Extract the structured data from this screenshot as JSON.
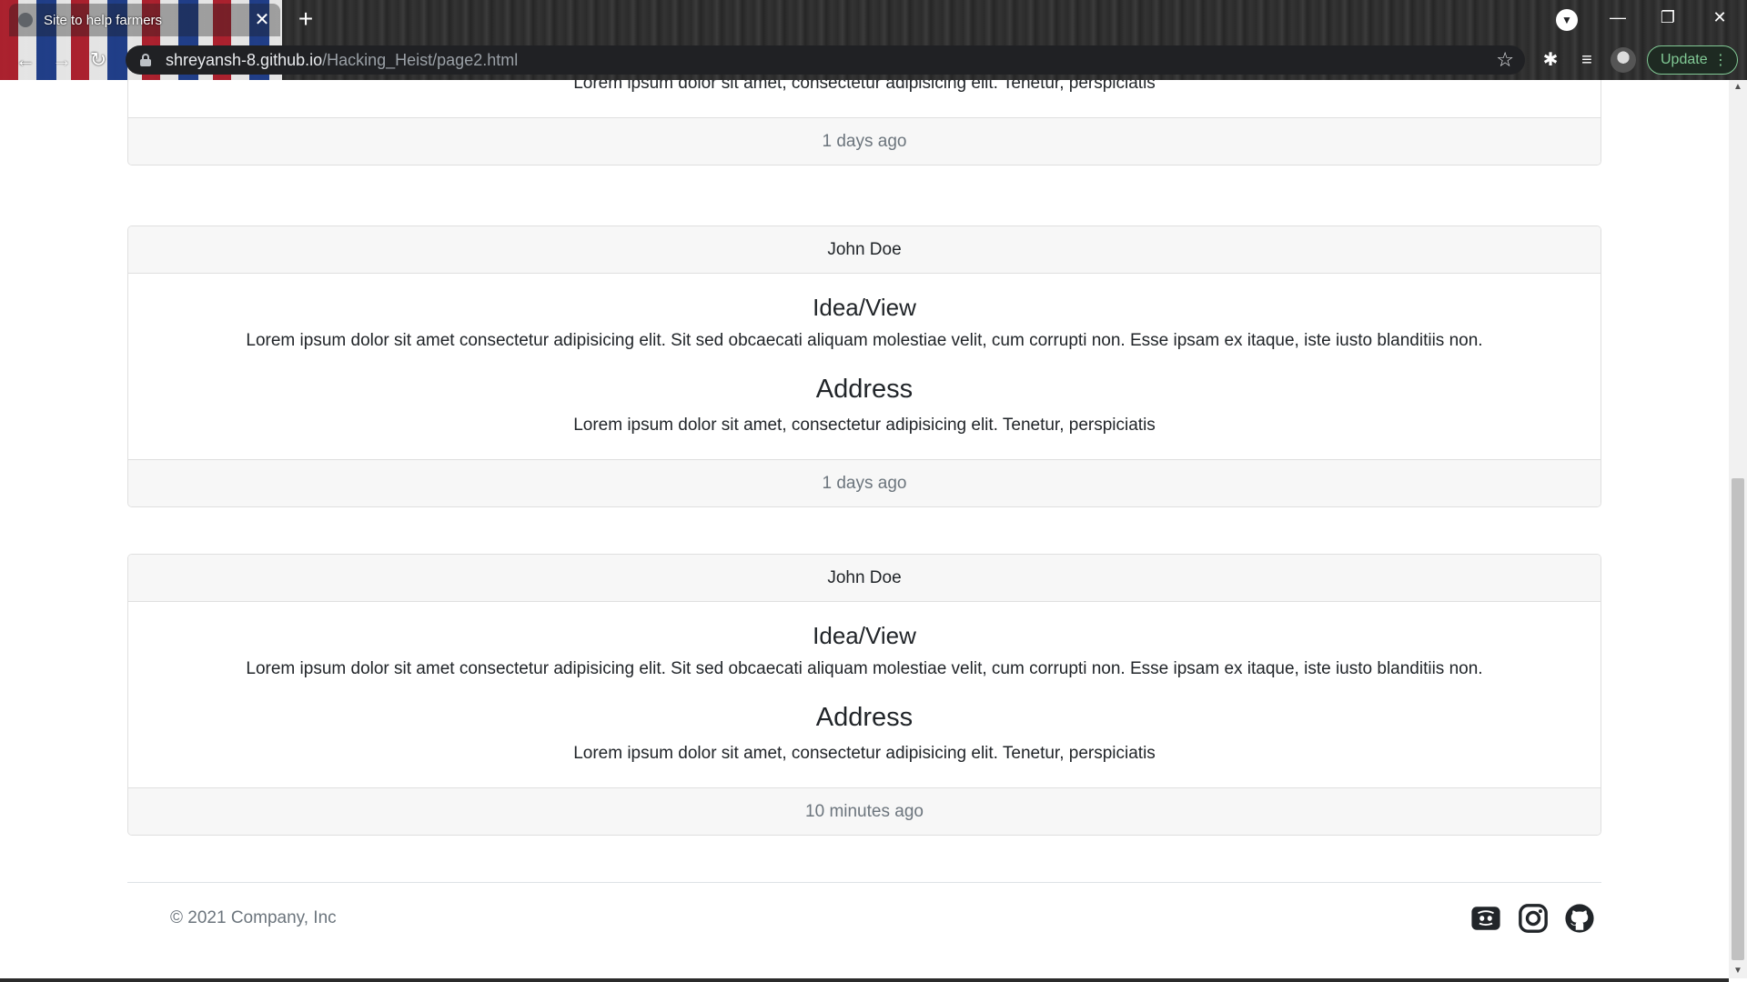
{
  "browser": {
    "tab_title": "Site to help farmers",
    "tab_close": "✕",
    "new_tab": "+",
    "url_host": "shreyansh-8.github.io",
    "url_path": "/Hacking_Heist/page2.html",
    "update_label": "Update"
  },
  "posts": [
    {
      "address_text": "Lorem ipsum dolor sit amet, consectetur adipisicing elit. Tenetur, perspiciatis",
      "time": "1 days ago"
    },
    {
      "author": "John Doe",
      "idea_title": "Idea/View",
      "idea_text": "Lorem ipsum dolor sit amet consectetur adipisicing elit. Sit sed obcaecati aliquam molestiae velit, cum corrupti non. Esse ipsam ex itaque, iste iusto blanditiis non.",
      "address_title": "Address",
      "address_text": "Lorem ipsum dolor sit amet, consectetur adipisicing elit. Tenetur, perspiciatis",
      "time": "1 days ago"
    },
    {
      "author": "John Doe",
      "idea_title": "Idea/View",
      "idea_text": "Lorem ipsum dolor sit amet consectetur adipisicing elit. Sit sed obcaecati aliquam molestiae velit, cum corrupti non. Esse ipsam ex itaque, iste iusto blanditiis non.",
      "address_title": "Address",
      "address_text": "Lorem ipsum dolor sit amet, consectetur adipisicing elit. Tenetur, perspiciatis",
      "time": "10 minutes ago"
    }
  ],
  "footer": {
    "copyright": "© 2021 Company, Inc",
    "icons": [
      "discord-icon",
      "instagram-icon",
      "github-icon"
    ]
  },
  "colors": {
    "card_bg": "#f7f7f7",
    "border": "#dfdfdf",
    "muted": "#6c757d",
    "text": "#212529"
  }
}
